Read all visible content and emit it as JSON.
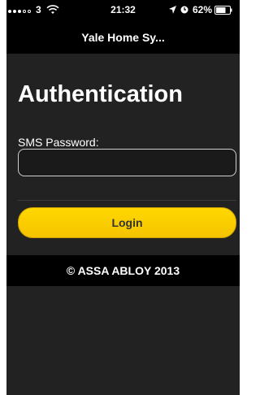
{
  "status_bar": {
    "carrier": "3",
    "time": "21:32",
    "battery": "62%",
    "icons": [
      "signal-dots",
      "wifi-icon",
      "location-arrow-icon",
      "alarm-clock-icon",
      "battery-icon"
    ]
  },
  "nav": {
    "title": "Yale Home Sy..."
  },
  "auth": {
    "title": "Authentication",
    "sms_label": "SMS Password:",
    "sms_value": "",
    "login_label": "Login"
  },
  "footer": {
    "text": "© ASSA ABLOY 2013"
  },
  "colors": {
    "accent": "#ffd700",
    "background": "#222222",
    "bar": "#000000"
  }
}
